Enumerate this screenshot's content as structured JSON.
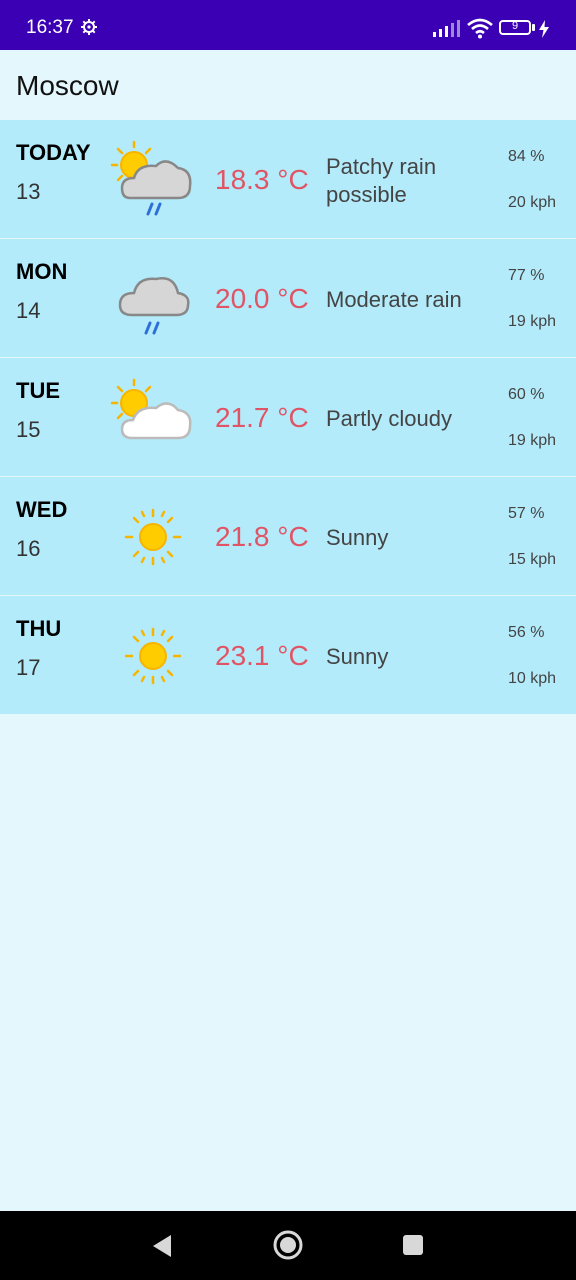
{
  "status": {
    "time": "16:37",
    "battery": "9"
  },
  "location": "Moscow",
  "forecast": [
    {
      "day": "TODAY",
      "date": "13",
      "icon": "patchy-rain-icon",
      "temp": "18.3 °C",
      "condition": "Patchy rain possible",
      "humidity": "84 %",
      "wind": "20 kph"
    },
    {
      "day": "MON",
      "date": "14",
      "icon": "moderate-rain-icon",
      "temp": "20.0 °C",
      "condition": "Moderate rain",
      "humidity": "77 %",
      "wind": "19 kph"
    },
    {
      "day": "TUE",
      "date": "15",
      "icon": "partly-cloudy-icon",
      "temp": "21.7 °C",
      "condition": "Partly cloudy",
      "humidity": "60 %",
      "wind": "19 kph"
    },
    {
      "day": "WED",
      "date": "16",
      "icon": "sunny-icon",
      "temp": "21.8 °C",
      "condition": "Sunny",
      "humidity": "57 %",
      "wind": "15 kph"
    },
    {
      "day": "THU",
      "date": "17",
      "icon": "sunny-icon",
      "temp": "23.1 °C",
      "condition": "Sunny",
      "humidity": "56 %",
      "wind": "10 kph"
    }
  ],
  "colors": {
    "status_bar": "#3b00b3",
    "row_bg": "#b3ebfb",
    "page_bg": "#e3f7fd",
    "temp": "#e05565"
  }
}
